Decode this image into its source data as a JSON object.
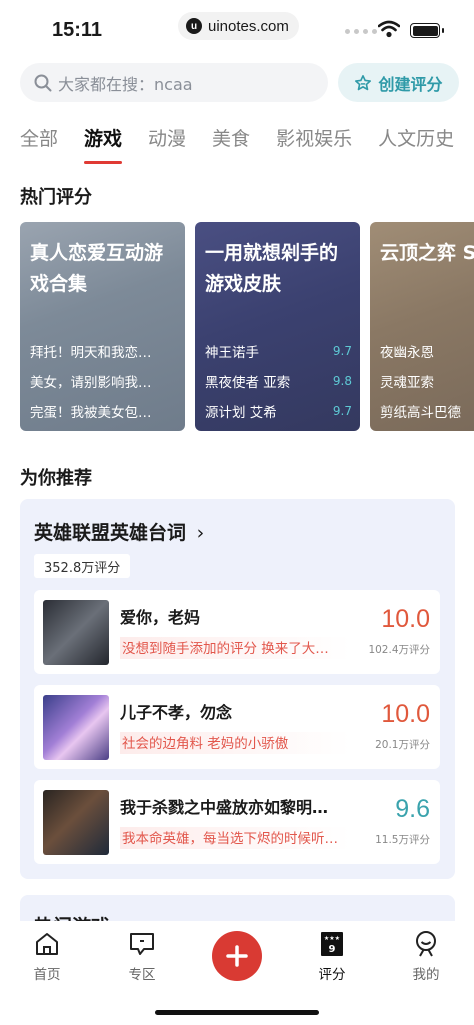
{
  "status": {
    "time": "15:11",
    "url": "uinotes.com"
  },
  "search": {
    "placeholder": "大家都在搜：ncaa",
    "create_label": "创建评分"
  },
  "tabs": [
    "全部",
    "游戏",
    "动漫",
    "美食",
    "影视娱乐",
    "人文历史"
  ],
  "active_tab": "游戏",
  "hot": {
    "title": "热门评分",
    "cards": [
      {
        "title": "真人恋爱互动游戏合集",
        "rows": [
          {
            "text": "拜托！明天和我恋…",
            "score": ""
          },
          {
            "text": "美女，请别影响我…",
            "score": ""
          },
          {
            "text": "完蛋！我被美女包…",
            "score": ""
          }
        ]
      },
      {
        "title": "一用就想剁手的游戏皮肤",
        "rows": [
          {
            "text": "神王诺手",
            "score": "9.7"
          },
          {
            "text": "黑夜使者 亚索",
            "score": "9.8"
          },
          {
            "text": "源计划 艾希",
            "score": "9.7"
          }
        ]
      },
      {
        "title": "云顶之弈 S 荐阵容",
        "rows": [
          {
            "text": "夜幽永恩",
            "score": ""
          },
          {
            "text": "灵魂亚索",
            "score": ""
          },
          {
            "text": "剪纸高斗巴德",
            "score": ""
          }
        ]
      }
    ]
  },
  "recommend": {
    "title": "为你推荐",
    "group_title": "英雄联盟英雄台词",
    "group_count": "352.8万评分",
    "items": [
      {
        "name": "爱你，老妈",
        "tagline": "没想到随手添加的评分 换来了大…",
        "score": "10.0",
        "count": "102.4万评分",
        "color": "#e0583c"
      },
      {
        "name": "儿子不孝，勿念",
        "tagline": "社会的边角料 老妈的小骄傲",
        "score": "10.0",
        "count": "20.1万评分",
        "color": "#e0583c"
      },
      {
        "name": "我于杀戮之中盛放亦如黎明…",
        "tagline": "我本命英雄，每当选下烬的时候听…",
        "score": "9.6",
        "count": "11.5万评分",
        "color": "#3aa3ad"
      }
    ]
  },
  "hot_games": {
    "title": "热门游戏"
  },
  "nav": [
    {
      "label": "首页",
      "icon": "home-icon"
    },
    {
      "label": "专区",
      "icon": "chat-icon"
    },
    {
      "label": "",
      "icon": "plus-icon"
    },
    {
      "label": "评分",
      "icon": "rating-icon"
    },
    {
      "label": "我的",
      "icon": "profile-icon"
    }
  ],
  "colors": {
    "accent": "#d93a33",
    "teal": "#2f9aa8"
  }
}
